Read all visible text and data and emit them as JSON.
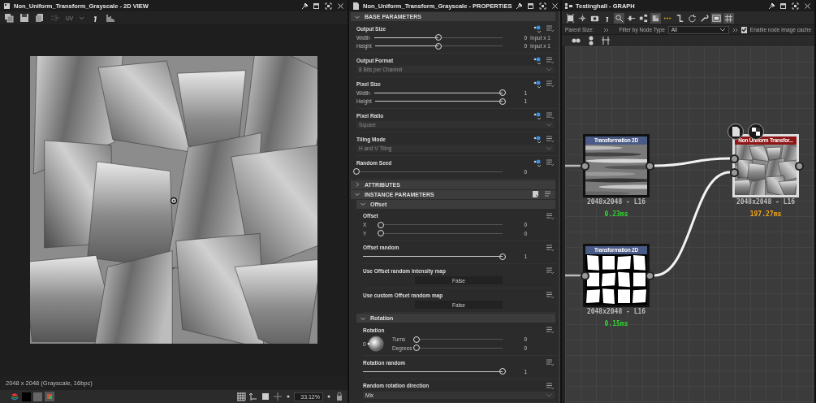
{
  "view2d": {
    "title": "Non_Uniform_Transform_Grayscale - 2D VIEW",
    "uv": {
      "label": "UV",
      "disabled": true
    },
    "status": "2048 x 2048 (Grayscale, 16bpc)",
    "zoom": "33.12%"
  },
  "properties": {
    "title": "Non_Uniform_Transform_Grayscale - PROPERTIES",
    "sections": [
      {
        "title": "BASE PARAMETERS",
        "expanded": true,
        "params": [
          {
            "kind": "sliders",
            "title": "Output Size",
            "linkable": true,
            "rows": [
              {
                "label": "Width",
                "level": 0.5,
                "value": "0",
                "suffix": "Input x 1"
              },
              {
                "label": "Height",
                "level": 0.5,
                "value": "0",
                "suffix": "Input x 1"
              }
            ]
          },
          {
            "kind": "dropdown",
            "title": "Output Format",
            "linkable": true,
            "value": "8 Bits per Channel",
            "disabled": true
          },
          {
            "kind": "sliders",
            "title": "Pixel Size",
            "linkable": true,
            "rows": [
              {
                "label": "Width",
                "level": 1,
                "value": "1"
              },
              {
                "label": "Height",
                "level": 1,
                "value": "1"
              }
            ]
          },
          {
            "kind": "dropdown",
            "title": "Pixel Ratio",
            "linkable": true,
            "value": "Square",
            "disabled": true
          },
          {
            "kind": "dropdown",
            "title": "Tiling Mode",
            "linkable": true,
            "value": "H and V Tiling",
            "disabled": true
          },
          {
            "kind": "sliders",
            "title": "Random Seed",
            "linkable": true,
            "rows": [
              {
                "level": 0,
                "value": "0"
              }
            ]
          }
        ]
      },
      {
        "title": "ATTRIBUTES",
        "expanded": false
      },
      {
        "title": "INSTANCE PARAMETERS",
        "expanded": true,
        "groups": [
          {
            "title": "Offset",
            "expanded": true,
            "params": [
              {
                "kind": "sliders",
                "title": "Offset",
                "linkable": false,
                "rows": [
                  {
                    "label": "X",
                    "level": 0,
                    "value": "0"
                  },
                  {
                    "label": "Y",
                    "level": 0,
                    "value": "0"
                  }
                ]
              },
              {
                "kind": "sliders",
                "title": "Offset random",
                "linkable": false,
                "rows": [
                  {
                    "level": 1,
                    "value": "1"
                  }
                ]
              },
              {
                "kind": "toggle",
                "title": "Use Offset random intensity map",
                "linkable": false,
                "value": "False"
              },
              {
                "kind": "toggle",
                "title": "Use custom Offset random map",
                "linkable": false,
                "value": "False"
              }
            ]
          },
          {
            "title": "Rotation",
            "expanded": true,
            "params": [
              {
                "kind": "rotation",
                "title": "Rotation",
                "linkable": false,
                "dial_label": "0",
                "rows": [
                  {
                    "label": "Turns",
                    "level": 0,
                    "value": "0"
                  },
                  {
                    "label": "Degrees",
                    "level": 0,
                    "value": "0"
                  }
                ]
              },
              {
                "kind": "sliders",
                "title": "Rotation random",
                "linkable": false,
                "rows": [
                  {
                    "level": 1,
                    "value": "1"
                  }
                ]
              },
              {
                "kind": "dropdown",
                "title": "Random rotation direction",
                "linkable": false,
                "value": "Mix",
                "disabled": false
              }
            ]
          }
        ]
      }
    ]
  },
  "graph": {
    "title": "Testinghall - GRAPH",
    "tools": [
      {
        "selected": false
      },
      {
        "selected": false
      },
      {
        "selected": false
      },
      {
        "selected": false
      },
      {
        "selected": true
      },
      {
        "selected": false
      },
      {
        "selected": false
      },
      {
        "selected": true
      },
      {
        "selected": false
      },
      {
        "selected": false
      },
      {
        "selected": false
      },
      {
        "selected": false
      },
      {
        "selected": true
      },
      {
        "selected": true
      }
    ],
    "parent_size_label": "Parent Size:",
    "filter_label": "Filter by Node Type",
    "filter_value": "All",
    "cache": {
      "label": "Enable node image cache",
      "checked": true
    },
    "nodes": [
      {
        "kind": "source",
        "title": "Transformation 2D",
        "color": "#4a5a86",
        "info": "2048x2048 - L16",
        "time": "0.23ms",
        "slow": false,
        "selected": false
      },
      {
        "kind": "source",
        "title": "Transformation 2D",
        "color": "#4a5a86",
        "info": "2048x2048 - L16",
        "time": "0.15ms",
        "slow": false,
        "selected": false
      },
      {
        "kind": "target",
        "title": "Non Uniform Transfor...",
        "color": "#8e1616",
        "info": "2048x2048 - L16",
        "time": "197.27ms",
        "slow": true,
        "selected": true
      }
    ]
  }
}
